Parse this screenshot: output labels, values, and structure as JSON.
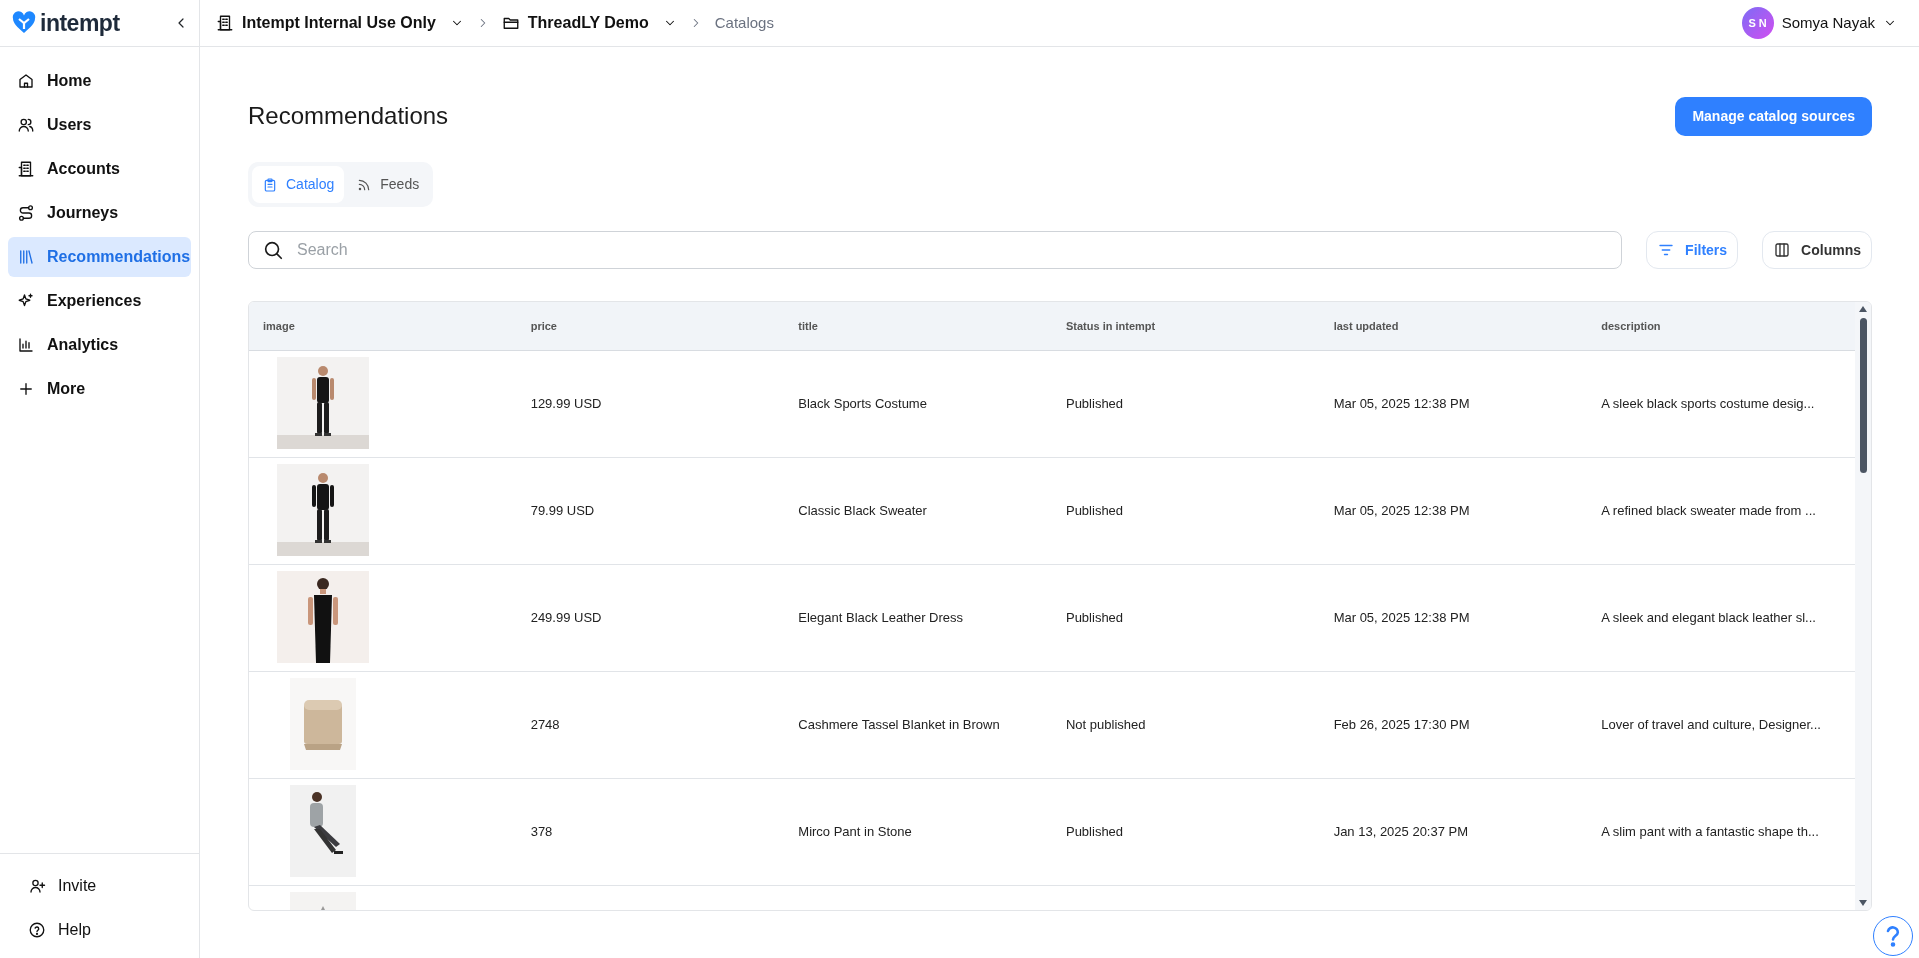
{
  "sidebar": {
    "logo": "intempt",
    "items": [
      {
        "label": "Home",
        "selected": false
      },
      {
        "label": "Users",
        "selected": false
      },
      {
        "label": "Accounts",
        "selected": false
      },
      {
        "label": "Journeys",
        "selected": false
      },
      {
        "label": "Recommendations",
        "selected": true
      },
      {
        "label": "Experiences",
        "selected": false
      },
      {
        "label": "Analytics",
        "selected": false
      },
      {
        "label": "More",
        "selected": false
      }
    ],
    "footer_items": [
      {
        "label": "Invite"
      },
      {
        "label": "Help"
      }
    ]
  },
  "header": {
    "breadcrumbs": [
      {
        "label": "Intempt Internal Use Only",
        "kind": "workspace"
      },
      {
        "label": "ThreadLY Demo",
        "kind": "project"
      },
      {
        "label": "Catalogs",
        "kind": "current"
      }
    ],
    "user": {
      "initials": "S N",
      "name": "Somya Nayak"
    }
  },
  "page": {
    "title": "Recommendations",
    "primary_button": "Manage catalog sources",
    "tabs": [
      {
        "label": "Catalog",
        "selected": true
      },
      {
        "label": "Feeds",
        "selected": false
      }
    ],
    "search": {
      "placeholder": "Search"
    },
    "filters_button": "Filters",
    "columns_button": "Columns"
  },
  "table": {
    "columns": [
      "image",
      "price",
      "title",
      "Status in intempt",
      "last updated",
      "description"
    ],
    "rows": [
      {
        "image": {
          "kind": "picture"
        },
        "price": "129.99 USD",
        "title": "Black Sports Costume",
        "status": "Published",
        "last_updated": "Mar 05, 2025 12:38 PM",
        "description": "A sleek black sports costume desig..."
      },
      {
        "image": {
          "kind": "picture"
        },
        "price": "79.99 USD",
        "title": "Classic Black Sweater",
        "status": "Published",
        "last_updated": "Mar 05, 2025 12:38 PM",
        "description": "A refined black sweater made from ..."
      },
      {
        "image": {
          "kind": "picture"
        },
        "price": "249.99 USD",
        "title": "Elegant Black Leather Dress",
        "status": "Published",
        "last_updated": "Mar 05, 2025 12:38 PM",
        "description": "A sleek and elegant black leather sl..."
      },
      {
        "image": {
          "kind": "picture"
        },
        "price": "2748",
        "title": "Cashmere Tassel Blanket in Brown",
        "status": "Not published",
        "last_updated": "Feb 26, 2025 17:30 PM",
        "description": "Lover of travel and culture, Designer..."
      },
      {
        "image": {
          "kind": "picture"
        },
        "price": "378",
        "title": "Mirco Pant in Stone",
        "status": "Published",
        "last_updated": "Jan 13, 2025 20:37 PM",
        "description": "A slim pant with a fantastic shape th..."
      },
      {
        "image": {
          "kind": "picture"
        }
      }
    ]
  }
}
